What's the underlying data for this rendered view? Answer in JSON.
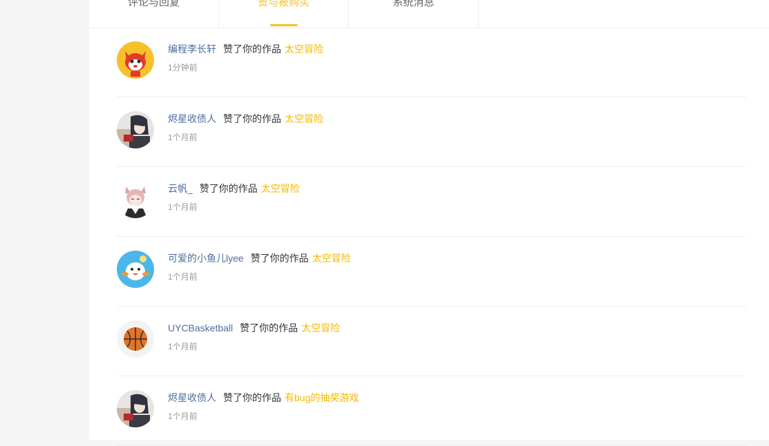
{
  "tabs": [
    {
      "label": "评论与回复",
      "active": false
    },
    {
      "label": "赞与被购买",
      "active": true
    },
    {
      "label": "系统消息",
      "active": false
    }
  ],
  "accent_color": "#f6c21c",
  "notifications": [
    {
      "user": "编程李长轩",
      "action": "赞了你的作品",
      "work": "太空冒险",
      "time": "1分钟前",
      "avatar": "fox-mascot-avatar"
    },
    {
      "user": "烬星收债人",
      "action": "赞了你的作品",
      "work": "太空冒险",
      "time": "1个月前",
      "avatar": "anime-boy-avatar"
    },
    {
      "user": "云帆_",
      "action": "赞了你的作品",
      "work": "太空冒险",
      "time": "1个月前",
      "avatar": "cat-ear-boy-avatar"
    },
    {
      "user": "可爱的小鱼儿lyee",
      "action": "赞了你的作品",
      "work": "太空冒险",
      "time": "1个月前",
      "avatar": "blue-mascot-avatar"
    },
    {
      "user": "UYCBasketball",
      "action": "赞了你的作品",
      "work": "太空冒险",
      "time": "1个月前",
      "avatar": "basketball-avatar"
    },
    {
      "user": "烬星收债人",
      "action": "赞了你的作品",
      "work": "有bug的抽奖游戏",
      "time": "1个月前",
      "avatar": "anime-boy-avatar"
    }
  ]
}
